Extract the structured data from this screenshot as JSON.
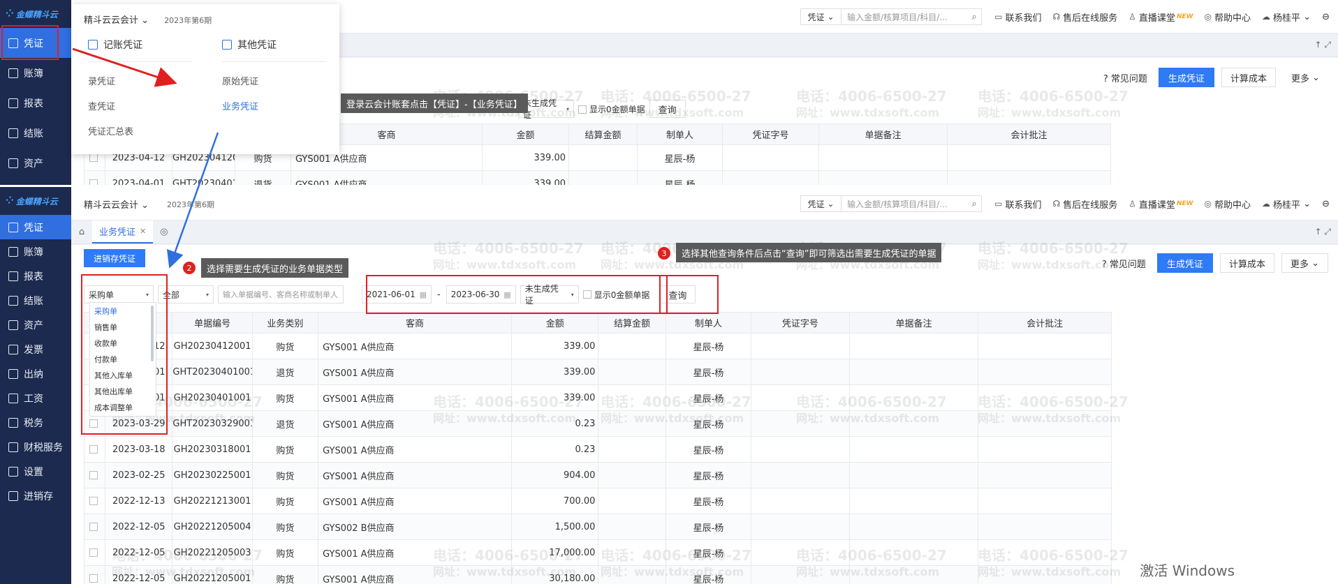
{
  "app": {
    "logo": "金蝶精斗云",
    "book": "精斗云云会计",
    "period": "2023年第6期"
  },
  "sidebar": {
    "items": [
      {
        "label": "凭证",
        "icon": "voucher-icon"
      },
      {
        "label": "账簿",
        "icon": "ledger-icon"
      },
      {
        "label": "报表",
        "icon": "report-icon"
      },
      {
        "label": "结账",
        "icon": "closing-icon"
      },
      {
        "label": "资产",
        "icon": "asset-icon"
      },
      {
        "label": "发票",
        "icon": "invoice-icon"
      },
      {
        "label": "出纳",
        "icon": "cashier-icon"
      },
      {
        "label": "工资",
        "icon": "salary-icon"
      },
      {
        "label": "税务",
        "icon": "tax-icon"
      },
      {
        "label": "财税服务",
        "icon": "service-icon"
      },
      {
        "label": "设置",
        "icon": "settings-icon"
      },
      {
        "label": "进销存",
        "icon": "inventory-icon"
      }
    ],
    "top_panel_partial": "账簿"
  },
  "header": {
    "search_type": "凭证",
    "search_placeholder": "输入金额/核算项目/科目/...",
    "links": {
      "contact": "联系我们",
      "support": "售后在线服务",
      "live": "直播课堂",
      "live_badge": "NEW",
      "help": "帮助中心",
      "user": "杨桂平"
    }
  },
  "menu": {
    "col1_title": "记账凭证",
    "col1_items": [
      "录凭证",
      "查凭证",
      "凭证汇总表"
    ],
    "col2_title": "其他凭证",
    "col2_items": [
      "原始凭证",
      "业务凭证"
    ]
  },
  "tab": {
    "label": "业务凭证"
  },
  "actions": {
    "faq": "常见问题",
    "generate": "生成凭证",
    "cost": "计算成本",
    "more": "更多",
    "inv_voucher": "进销存凭证"
  },
  "filters": {
    "doc_type": "采购单",
    "biz_type": "全部",
    "keyword_placeholder": "输入单据编号、客商名称或制单人",
    "date_from": "2021-06-01",
    "date_to": "2023-06-30",
    "date_sep": "-",
    "status": "未生成凭证",
    "show_zero": "显示0金额单据",
    "query": "查询"
  },
  "dropdown": {
    "options": [
      "采购单",
      "销售单",
      "收款单",
      "付款单",
      "其他入库单",
      "其他出库单",
      "成本调整单"
    ]
  },
  "table": {
    "headers": [
      "单据日期",
      "单据编号",
      "业务类别",
      "客商",
      "金额",
      "结算金额",
      "制单人",
      "凭证字号",
      "单据备注",
      "会计批注"
    ],
    "rows": [
      {
        "date": "2023-04-12",
        "no": "GH20230412001",
        "type": "购货",
        "party": "GYS001 A供应商",
        "amount": "339.00",
        "maker": "星辰-杨"
      },
      {
        "date": "2023-04-01",
        "no": "GHT20230401001",
        "type": "退货",
        "party": "GYS001 A供应商",
        "amount": "339.00",
        "maker": "星辰-杨"
      },
      {
        "date": "2023-04-01",
        "no": "GH20230401001",
        "type": "购货",
        "party": "GYS001 A供应商",
        "amount": "339.00",
        "maker": "星辰-杨"
      },
      {
        "date": "2023-03-29",
        "no": "GHT20230329001",
        "type": "退货",
        "party": "GYS001 A供应商",
        "amount": "0.23",
        "maker": "星辰-杨"
      },
      {
        "date": "2023-03-18",
        "no": "GH20230318001",
        "type": "购货",
        "party": "GYS001 A供应商",
        "amount": "0.23",
        "maker": "星辰-杨"
      },
      {
        "date": "2023-02-25",
        "no": "GH20230225001",
        "type": "购货",
        "party": "GYS001 A供应商",
        "amount": "904.00",
        "maker": "星辰-杨"
      },
      {
        "date": "2022-12-13",
        "no": "GH20221213001",
        "type": "购货",
        "party": "GYS001 A供应商",
        "amount": "700.00",
        "maker": "星辰-杨"
      },
      {
        "date": "2022-12-05",
        "no": "GH20221205004",
        "type": "购货",
        "party": "GYS002 B供应商",
        "amount": "1,500.00",
        "maker": "星辰-杨"
      },
      {
        "date": "2022-12-05",
        "no": "GH20221205003",
        "type": "购货",
        "party": "GYS001 A供应商",
        "amount": "17,000.00",
        "maker": "星辰-杨"
      },
      {
        "date": "2022-12-05",
        "no": "GH20221205001",
        "type": "购货",
        "party": "GYS001 A供应商",
        "amount": "30,180.00",
        "maker": "星辰-杨"
      }
    ],
    "top_rows": [
      {
        "date": "2023-04-12",
        "no": "GH20230412001",
        "type": "购货",
        "party": "GYS001 A供应商",
        "amount": "339.00",
        "maker": "星辰-杨"
      },
      {
        "date": "2023-04-01",
        "no": "GHT20230401001",
        "type": "退货",
        "party": "GYS001 A供应商",
        "amount": "339.00",
        "maker": "星辰-杨"
      }
    ]
  },
  "callouts": {
    "step1": "登录云会计账套点击【凭证】-【业务凭证】",
    "step2": "选择需要生成凭证的业务单据类型",
    "step3": "选择其他查询条件后点击“查询”即可筛选出需要生成凭证的单据",
    "n1": "1",
    "n2": "2",
    "n3": "3"
  },
  "top_partial": {
    "date_to": "2023-06-30",
    "status": "未生成凭证"
  },
  "watermark": {
    "phone": "电话：4006-6500-27",
    "site": "网址：www.tdxsoft.com",
    "phone_short": "4006-6500-27"
  },
  "os": {
    "activate": "激活 Windows"
  },
  "colors": {
    "sidebar": "#1b2a4e",
    "active": "#2f6fe0",
    "primary": "#2f7af5",
    "annotation": "#e02020"
  }
}
